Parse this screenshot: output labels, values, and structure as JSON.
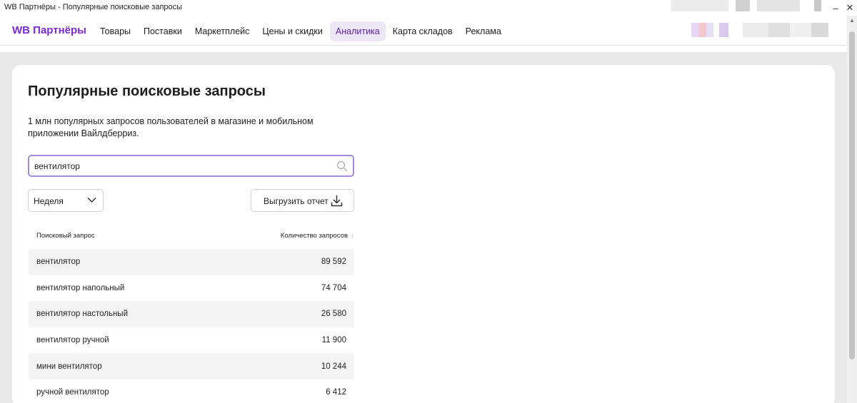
{
  "window": {
    "title": "WB Партнёры - Популярные поисковые запросы"
  },
  "header": {
    "logo": "WB Партнёры",
    "nav": [
      {
        "label": "Товары",
        "active": false
      },
      {
        "label": "Поставки",
        "active": false
      },
      {
        "label": "Маркетплейс",
        "active": false
      },
      {
        "label": "Цены и скидки",
        "active": false
      },
      {
        "label": "Аналитика",
        "active": true
      },
      {
        "label": "Карта складов",
        "active": false
      },
      {
        "label": "Реклама",
        "active": false
      }
    ]
  },
  "page": {
    "title": "Популярные поисковые запросы",
    "description": "1 млн популярных запросов пользователей в магазине и мобильном приложении Вайлдберриз."
  },
  "search": {
    "value": "вентилятор",
    "icon": "search-icon"
  },
  "period_select": {
    "value": "Неделя",
    "icon": "chevron-down-icon"
  },
  "export": {
    "label": "Выгрузить отчет",
    "icon": "download-icon"
  },
  "table": {
    "columns": {
      "query": "Поисковый запрос",
      "count": "Количество запросов"
    },
    "sort_icon": "sort-down-arrow-icon",
    "rows": [
      {
        "query": "вентилятор",
        "count": "89 592"
      },
      {
        "query": "вентилятор напольный",
        "count": "74 704"
      },
      {
        "query": "вентилятор настольный",
        "count": "26 580"
      },
      {
        "query": "вентилятор ручной",
        "count": "11 900"
      },
      {
        "query": "мини вентилятор",
        "count": "10 244"
      },
      {
        "query": "ручной вентилятор",
        "count": "6 412"
      }
    ]
  },
  "colors": {
    "brand": "#7a2ad0",
    "active_nav_bg": "#ece6f5",
    "search_border": "#a58be0",
    "row_stripe": "#f4f4f5",
    "page_bg": "#e9e9ea"
  }
}
